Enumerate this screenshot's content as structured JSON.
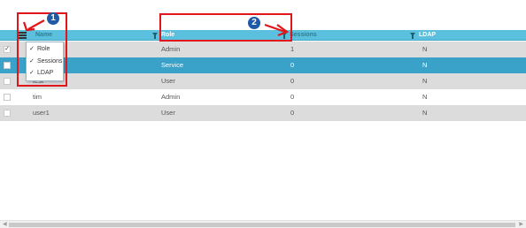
{
  "columns": {
    "name": "Name",
    "role": "Role",
    "sessions": "Sessions",
    "ldap": "LDAP"
  },
  "rows": [
    {
      "name": "",
      "role": "Admin",
      "sessions": "1",
      "ldap": "N",
      "checked": true,
      "state": "normal"
    },
    {
      "name": "",
      "role": "Service",
      "sessions": "0",
      "ldap": "N",
      "checked": false,
      "state": "selected"
    },
    {
      "name": "test",
      "role": "User",
      "sessions": "0",
      "ldap": "N",
      "checked": false,
      "state": "normal"
    },
    {
      "name": "tim",
      "role": "Admin",
      "sessions": "0",
      "ldap": "N",
      "checked": false,
      "state": "normal"
    },
    {
      "name": "user1",
      "role": "User",
      "sessions": "0",
      "ldap": "N",
      "checked": false,
      "state": "normal"
    }
  ],
  "column_menu": {
    "items": [
      {
        "label": "Role",
        "checked": true
      },
      {
        "label": "Sessions",
        "checked": true
      },
      {
        "label": "LDAP",
        "checked": true
      }
    ]
  },
  "annotations": {
    "badge_1": "1",
    "badge_2": "2",
    "highlight_color": "#e0161b",
    "badge_color": "#1f5aa8"
  },
  "checkmark": "✓",
  "colors": {
    "header": "#5bc0de",
    "selected_row": "#3aa1c8",
    "odd_row": "#dcdcdc"
  }
}
